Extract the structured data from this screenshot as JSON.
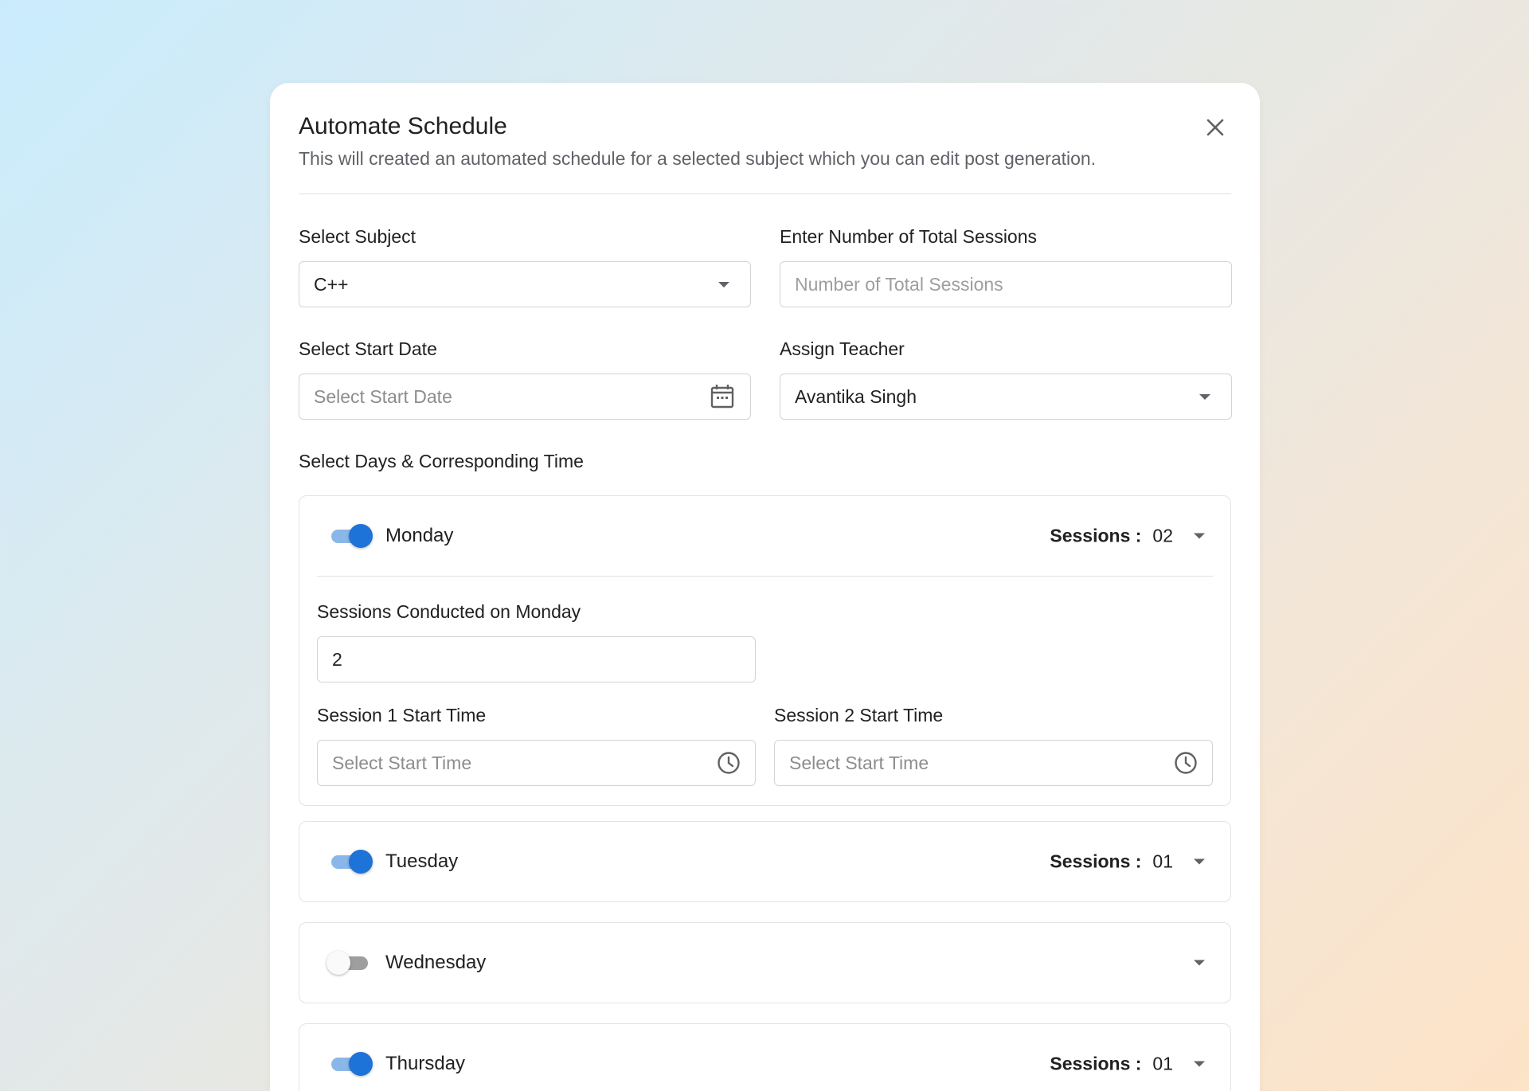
{
  "modal": {
    "title": "Automate Schedule",
    "subtitle": "This will created an automated schedule for a selected subject which you can edit post generation."
  },
  "form": {
    "subject": {
      "label": "Select Subject",
      "value": "C++"
    },
    "total_sessions": {
      "label": "Enter Number of Total Sessions",
      "placeholder": "Number of Total Sessions",
      "value": ""
    },
    "start_date": {
      "label": "Select Start Date",
      "placeholder": "Select Start Date"
    },
    "teacher": {
      "label": "Assign Teacher",
      "value": "Avantika Singh"
    },
    "days_section_label": "Select Days & Corresponding Time"
  },
  "days": {
    "monday": {
      "name": "Monday",
      "enabled": true,
      "sessions_label": "Sessions :",
      "sessions_value": "02",
      "conducted_label": "Sessions Conducted on Monday",
      "conducted_value": "2",
      "session1_label": "Session 1 Start Time",
      "session1_placeholder": "Select Start Time",
      "session2_label": "Session 2 Start Time",
      "session2_placeholder": "Select Start Time"
    },
    "tuesday": {
      "name": "Tuesday",
      "enabled": true,
      "sessions_label": "Sessions :",
      "sessions_value": "01"
    },
    "wednesday": {
      "name": "Wednesday",
      "enabled": false
    },
    "thursday": {
      "name": "Thursday",
      "enabled": true,
      "sessions_label": "Sessions :",
      "sessions_value": "01"
    }
  },
  "colors": {
    "toggle_on": "#1e73d8",
    "toggle_track_on": "#8ab7e9",
    "toggle_off": "#9e9e9e"
  }
}
